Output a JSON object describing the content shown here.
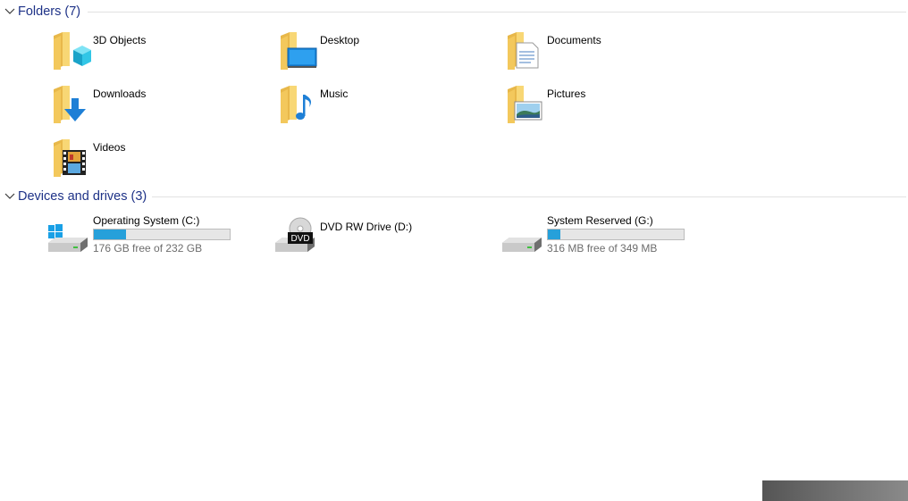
{
  "groups": {
    "folders": {
      "title": "Folders (7)",
      "items": [
        {
          "label": "3D Objects",
          "icon": "3d-objects-folder-icon"
        },
        {
          "label": "Desktop",
          "icon": "desktop-folder-icon"
        },
        {
          "label": "Documents",
          "icon": "documents-folder-icon"
        },
        {
          "label": "Downloads",
          "icon": "downloads-folder-icon"
        },
        {
          "label": "Music",
          "icon": "music-folder-icon"
        },
        {
          "label": "Pictures",
          "icon": "pictures-folder-icon"
        },
        {
          "label": "Videos",
          "icon": "videos-folder-icon"
        }
      ]
    },
    "drives": {
      "title": "Devices and drives (3)",
      "items": [
        {
          "name": "Operating System (C:)",
          "free": "176 GB free of 232 GB",
          "used_fraction": 0.24,
          "icon": "windows-drive-icon"
        },
        {
          "name": "DVD RW Drive (D:)",
          "icon": "dvd-drive-icon"
        },
        {
          "name": "System Reserved (G:)",
          "free": "316 MB free of 349 MB",
          "used_fraction": 0.095,
          "icon": "hard-drive-icon"
        }
      ]
    }
  },
  "colors": {
    "header_text": "#1e3287",
    "bar_fill": "#26a0da",
    "bar_track": "#e6e6e6",
    "folder_yellow": "#f8d775"
  }
}
